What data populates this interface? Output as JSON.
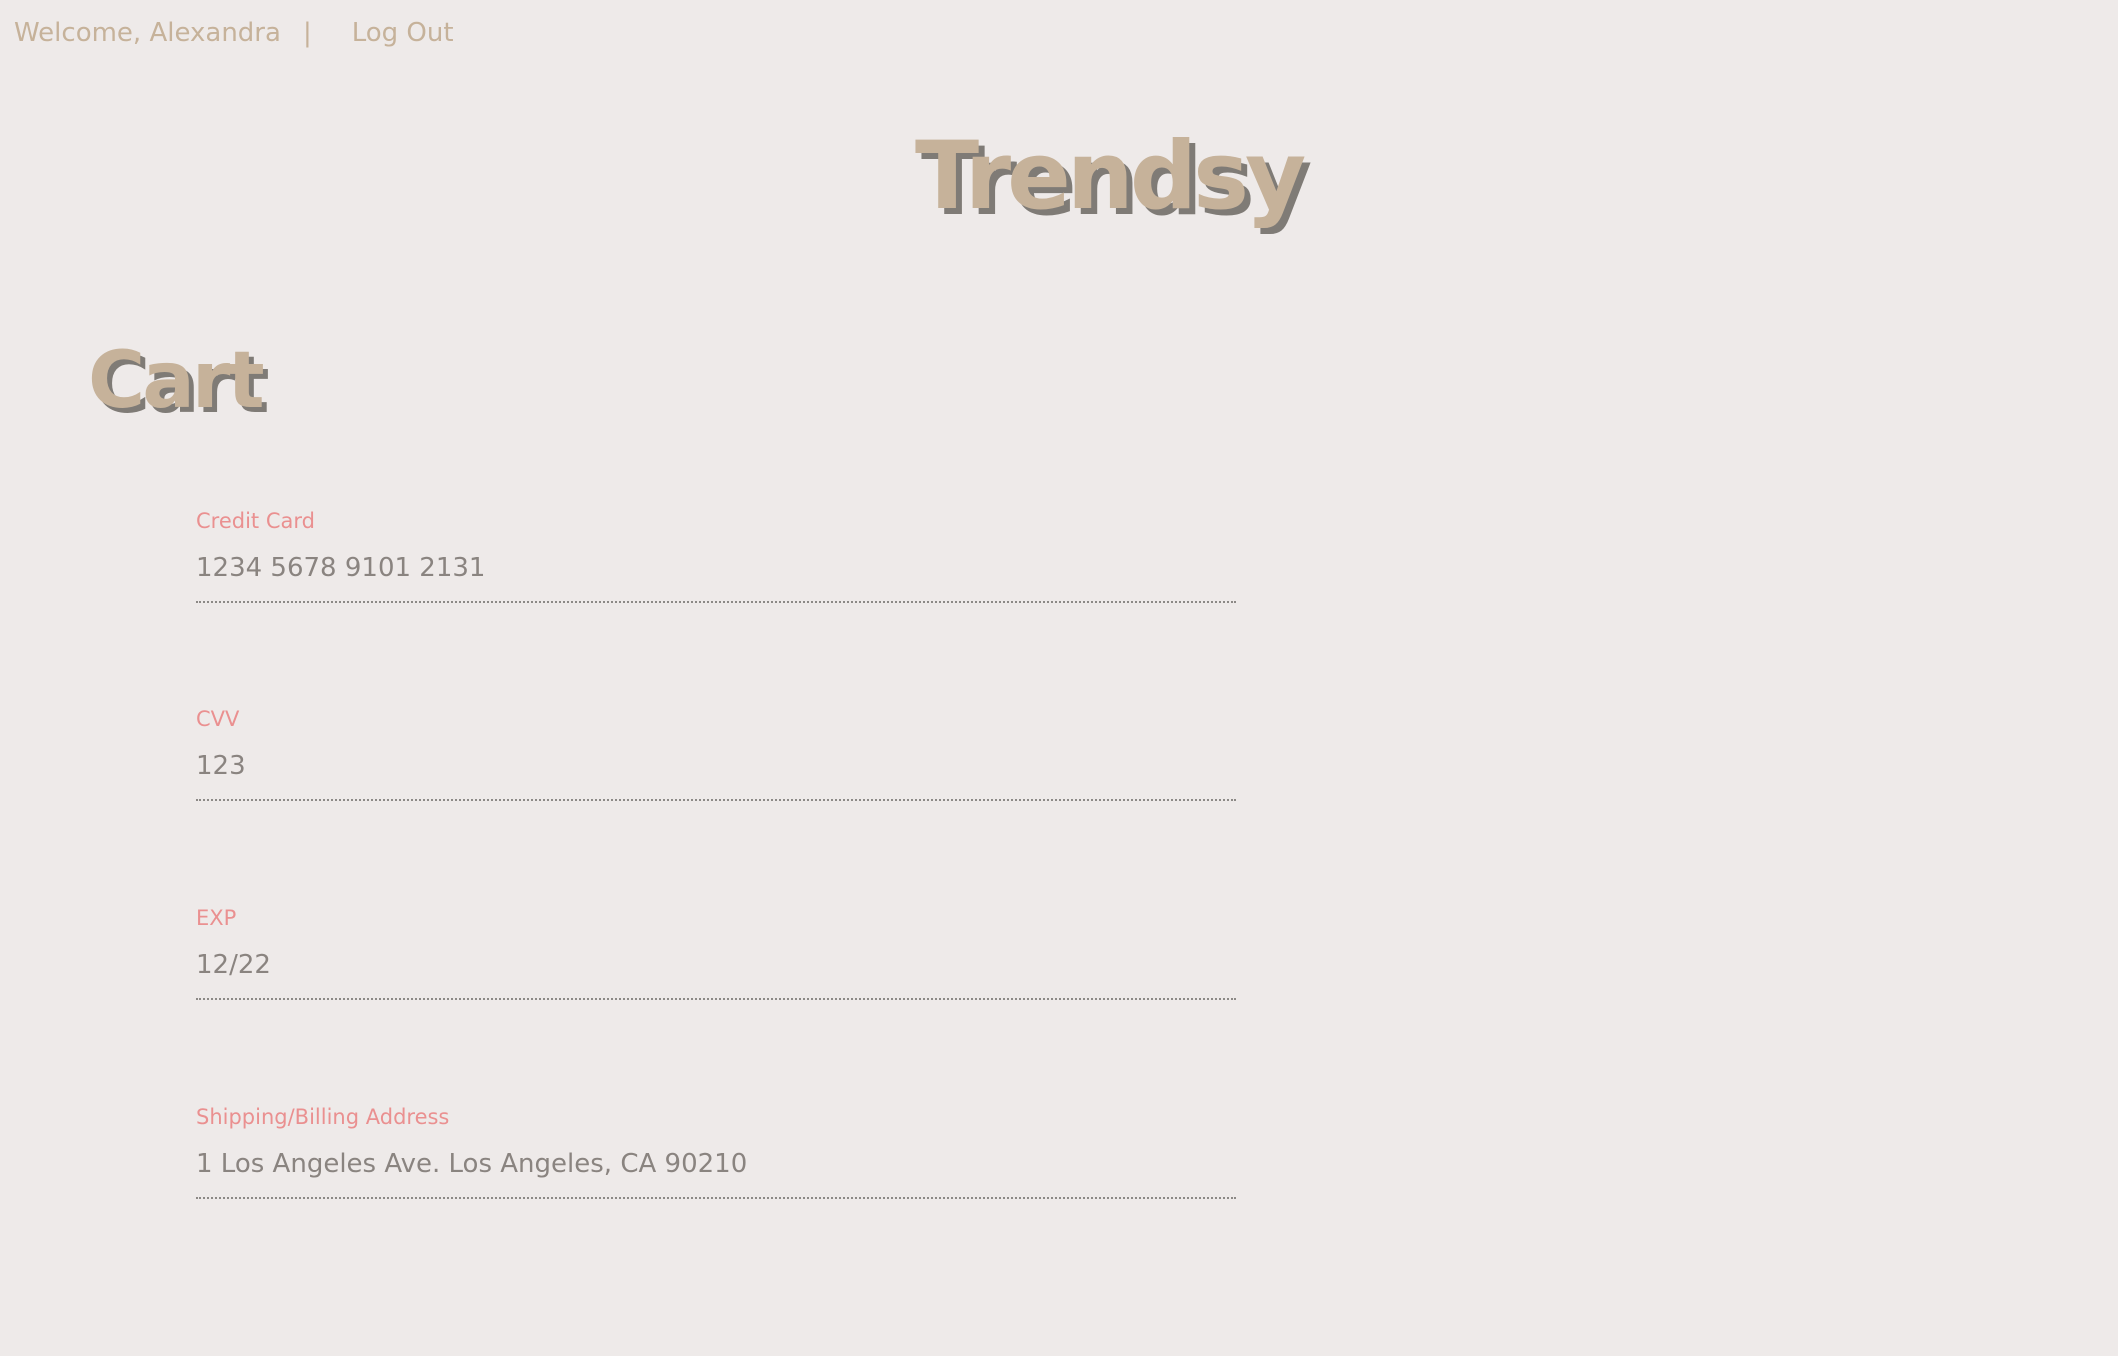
{
  "header": {
    "welcome_text": "Welcome, Alexandra",
    "separator": "|",
    "logout_label": "Log Out"
  },
  "brand": {
    "name": "Trendsy"
  },
  "cart": {
    "title": "Cart",
    "fields": [
      {
        "label": "Credit Card",
        "value": "1234 5678 9101 2131"
      },
      {
        "label": "CVV",
        "value": "123"
      },
      {
        "label": "EXP",
        "value": "12/22"
      },
      {
        "label": "Shipping/Billing Address",
        "value": "1 Los Angeles Ave. Los Angeles, CA 90210"
      }
    ]
  },
  "colors": {
    "background": "#eeeae9",
    "brand_tan": "#c6b29a",
    "shadow_gray": "#7f7b76",
    "label_pink": "#ea9090",
    "value_gray": "#8a8480"
  }
}
